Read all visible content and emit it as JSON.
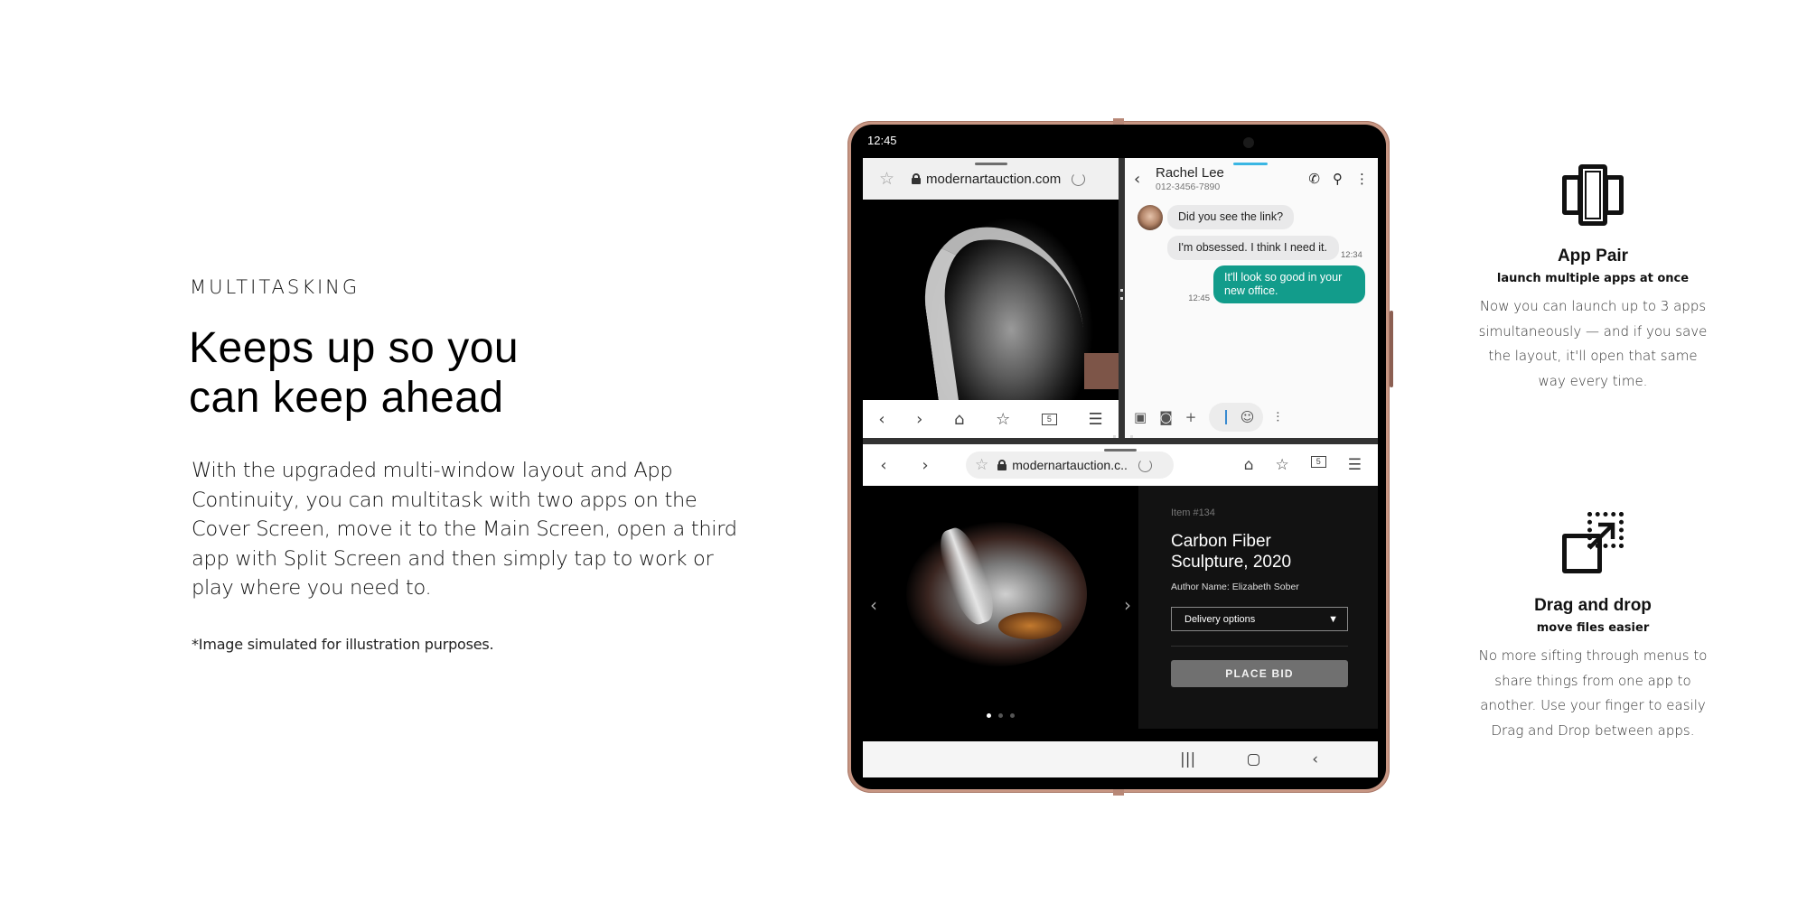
{
  "hero": {
    "eyebrow": "MULTITASKING",
    "headline_lines": [
      "Keeps up so you",
      "can keep ahead"
    ],
    "body": "With the upgraded multi-window layout and App Continuity, you can multitask with two apps on the Cover Screen, move it to the Main Screen, open a third app with Split Screen and then simply tap to work or play where you need to.",
    "disclaimer": "*Image simulated for illustration purposes."
  },
  "device": {
    "status_time": "12:45",
    "browser_top": {
      "url": "modernartauction.com",
      "star_icon": "star-outline-icon",
      "lock_icon": "lock-icon",
      "refresh_icon": "refresh-icon",
      "nav_icons": [
        "back-icon",
        "forward-icon",
        "home-icon",
        "bookmarks-icon",
        "tabs-icon",
        "menu-icon"
      ],
      "tabs_count": "5"
    },
    "messages": {
      "contact_name": "Rachel Lee",
      "contact_number": "012-3456-7890",
      "header_icons": [
        "phone-icon",
        "search-icon",
        "more-icon"
      ],
      "thread": [
        {
          "direction": "in",
          "text": "Did you see the link?"
        },
        {
          "direction": "in",
          "text": "I'm obsessed. I think I need it.",
          "time": "12:34"
        },
        {
          "direction": "out",
          "text": "It'll look so good in your new office.",
          "time": "12:45"
        }
      ],
      "composer_icons": [
        "gallery-icon",
        "camera-icon",
        "add-icon",
        "sticker-icon",
        "voice-icon"
      ],
      "accent": "#129c8b"
    },
    "browser_bottom": {
      "url": "modernartauction.c..",
      "tabs_count": "5",
      "item_number": "Item #134",
      "item_title": "Carbon Fiber Sculpture, 2020",
      "author": "Author Name: Elizabeth Sober",
      "dropdown_value": "Delivery options",
      "cta": "PLACE BID",
      "carousel_pages": 3,
      "carousel_active": 1
    },
    "system_nav": [
      "recents-icon",
      "home-icon",
      "back-icon"
    ]
  },
  "features": [
    {
      "icon": "app-pair-icon",
      "title": "App Pair",
      "subtitle": "launch multiple apps at once",
      "description": "Now you can launch up to 3 apps simultaneously — and if you save the layout, it'll open that same way every time."
    },
    {
      "icon": "drag-and-drop-icon",
      "title": "Drag and drop",
      "subtitle": "move files easier",
      "description": "No more sifting through menus to share things from one app to another. Use your finger to easily Drag and Drop between apps."
    }
  ]
}
